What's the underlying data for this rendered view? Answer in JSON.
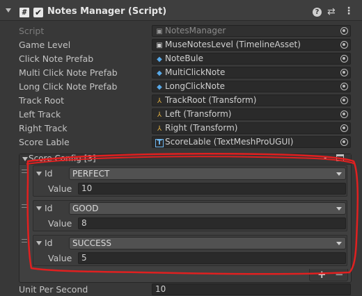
{
  "header": {
    "script_icon": "#",
    "enabled_check": "✔",
    "title": "Notes Manager (Script)",
    "help_icon": "?",
    "preset_icon": "⇄",
    "menu_icon": "⋮"
  },
  "fields": [
    {
      "label": "Script",
      "value": "NotesManager",
      "icon": "script-icon",
      "icon_glyph": "▣",
      "icon_color": "#9a9a9a",
      "disabled": true
    },
    {
      "label": "Game Level",
      "value": "MuseNotesLevel (TimelineAsset)",
      "icon": "timeline-asset-icon",
      "icon_glyph": "▣",
      "icon_color": "#cfcfcf"
    },
    {
      "label": "Click Note Prefab",
      "value": "NoteBule",
      "icon": "prefab-icon",
      "icon_glyph": "◆",
      "icon_color": "#58a9e8"
    },
    {
      "label": "Multi Click Note Prefab",
      "value": "MultiClickNote",
      "icon": "prefab-icon",
      "icon_glyph": "◆",
      "icon_color": "#58a9e8"
    },
    {
      "label": "Long Click Note Prefab",
      "value": "LongClickNote",
      "icon": "prefab-icon",
      "icon_glyph": "◆",
      "icon_color": "#58a9e8"
    },
    {
      "label": "Track Root",
      "value": "TrackRoot (Transform)",
      "icon": "transform-icon",
      "icon_glyph": "⅄",
      "icon_color": "#e0b040"
    },
    {
      "label": "Left Track",
      "value": "Left (Transform)",
      "icon": "transform-icon",
      "icon_glyph": "⅄",
      "icon_color": "#e0b040"
    },
    {
      "label": "Right Track",
      "value": "Right (Transform)",
      "icon": "transform-icon",
      "icon_glyph": "⅄",
      "icon_color": "#e0b040"
    },
    {
      "label": "Score Lable",
      "value": "ScoreLable (TextMeshProUGUI)",
      "icon": "textmeshpro-icon",
      "icon_glyph": "T",
      "icon_color": "#6fb7f0"
    }
  ],
  "score_config": {
    "title": "Score Config [3]",
    "collapse_label": "-",
    "items": [
      {
        "id_label": "Id",
        "id_value": "PERFECT",
        "value_label": "Value",
        "value": "10"
      },
      {
        "id_label": "Id",
        "id_value": "GOOD",
        "value_label": "Value",
        "value": "8"
      },
      {
        "id_label": "Id",
        "id_value": "SUCCESS",
        "value_label": "Value",
        "value": "5"
      }
    ],
    "add_label": "+",
    "remove_label": "−"
  },
  "unit_per_second": {
    "label": "Unit Per Second",
    "value": "10"
  },
  "colors": {
    "annotation": "#e02020",
    "background": "#383838",
    "field_bg": "#2a2a2a"
  }
}
